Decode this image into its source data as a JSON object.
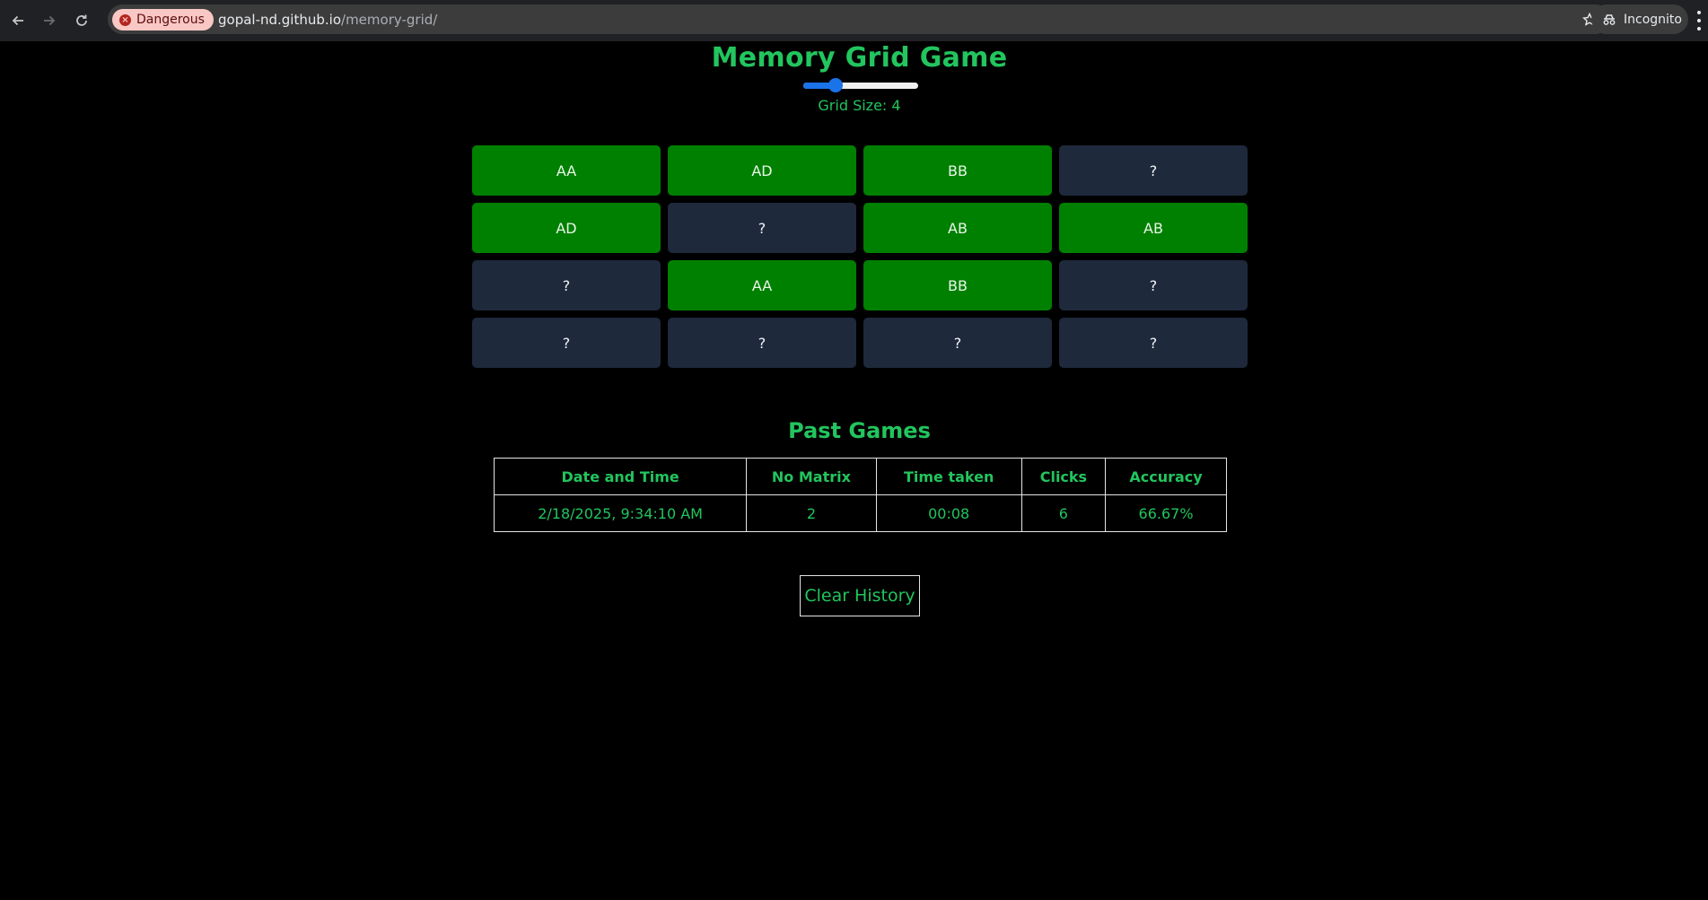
{
  "browser": {
    "security_chip": "Dangerous",
    "url_host": "gopal-nd.github.io",
    "url_path": "/memory-grid/",
    "profile_label": "Incognito"
  },
  "game": {
    "title": "Memory Grid Game",
    "grid_size_label": "Grid Size: 4",
    "slider_fraction": 0.28,
    "cells": [
      {
        "label": "AA",
        "revealed": true
      },
      {
        "label": "AD",
        "revealed": true
      },
      {
        "label": "BB",
        "revealed": true
      },
      {
        "label": "?",
        "revealed": false
      },
      {
        "label": "AD",
        "revealed": true
      },
      {
        "label": "?",
        "revealed": false
      },
      {
        "label": "AB",
        "revealed": true
      },
      {
        "label": "AB",
        "revealed": true
      },
      {
        "label": "?",
        "revealed": false
      },
      {
        "label": "AA",
        "revealed": true
      },
      {
        "label": "BB",
        "revealed": true
      },
      {
        "label": "?",
        "revealed": false
      },
      {
        "label": "?",
        "revealed": false
      },
      {
        "label": "?",
        "revealed": false
      },
      {
        "label": "?",
        "revealed": false
      },
      {
        "label": "?",
        "revealed": false
      }
    ]
  },
  "history": {
    "title": "Past Games",
    "columns": [
      "Date and Time",
      "No Matrix",
      "Time taken",
      "Clicks",
      "Accuracy"
    ],
    "rows": [
      [
        "2/18/2025, 9:34:10 AM",
        "2",
        "00:08",
        "6",
        "66.67%"
      ]
    ],
    "clear_label": "Clear History"
  },
  "colors": {
    "accent_green": "#22c55e",
    "revealed_cell": "#008000",
    "hidden_cell": "#1e293b",
    "slider_blue": "#1a73e8"
  }
}
